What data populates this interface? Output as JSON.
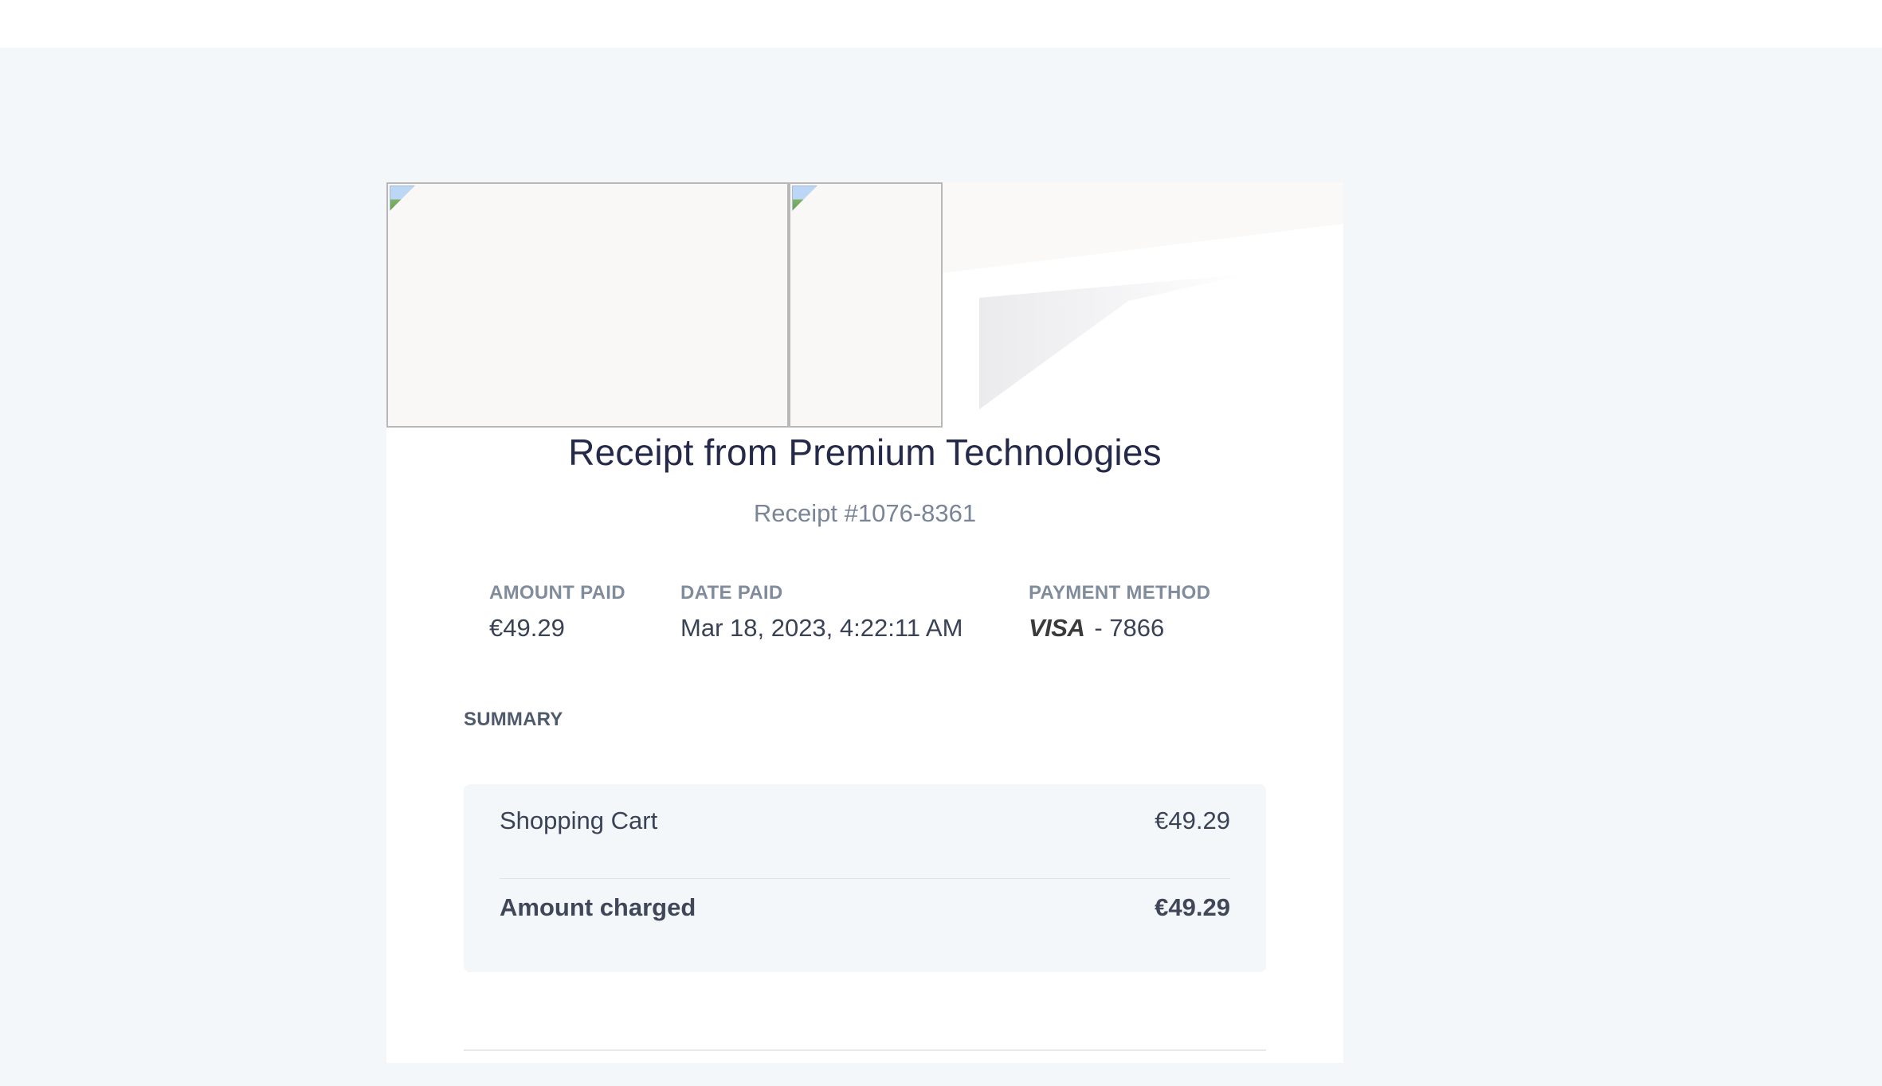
{
  "receipt": {
    "title": "Receipt from Premium Technologies",
    "number": "Receipt #1076-8361"
  },
  "meta": {
    "amount_paid": {
      "label": "AMOUNT PAID",
      "value": "€49.29"
    },
    "date_paid": {
      "label": "DATE PAID",
      "value": "Mar 18, 2023, 4:22:11 AM"
    },
    "payment_method": {
      "label": "PAYMENT METHOD",
      "card_brand": "VISA",
      "last4": "- 7866"
    }
  },
  "summary": {
    "heading": "SUMMARY",
    "items": [
      {
        "label": "Shopping Cart",
        "amount": "€49.29"
      }
    ],
    "total": {
      "label": "Amount charged",
      "amount": "€49.29"
    }
  },
  "icons": {
    "broken_image": "broken-image-icon",
    "card_brand": "visa-logo"
  },
  "colors": {
    "page_background": "#f4f7fa",
    "card_background": "#ffffff",
    "title_text": "#262a4a",
    "muted_text": "#808b9b",
    "body_text": "#3a4256"
  }
}
